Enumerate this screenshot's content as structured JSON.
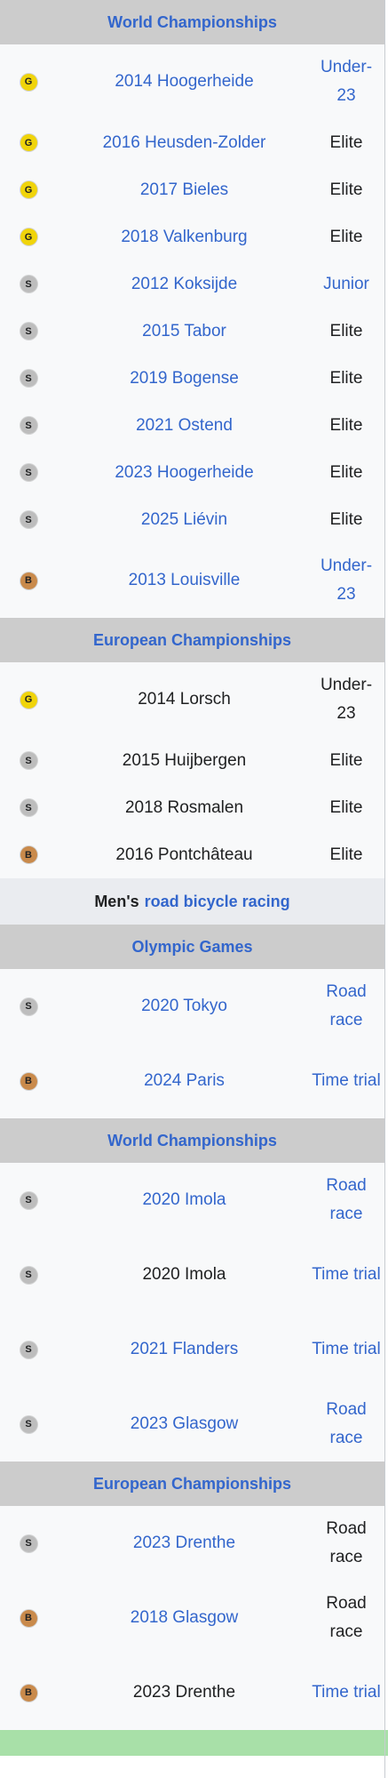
{
  "sections": [
    {
      "type": "header",
      "title": "World Championships",
      "rows": [
        {
          "medal": "G",
          "kind": "gold",
          "event": "2014 Hoogerheide",
          "event_link": true,
          "category": "Under-23",
          "cat_link": true,
          "tall": true
        },
        {
          "medal": "G",
          "kind": "gold",
          "event": "2016 Heusden-Zolder",
          "event_link": true,
          "category": "Elite",
          "cat_link": false,
          "tall": false
        },
        {
          "medal": "G",
          "kind": "gold",
          "event": "2017 Bieles",
          "event_link": true,
          "category": "Elite",
          "cat_link": false,
          "tall": false
        },
        {
          "medal": "G",
          "kind": "gold",
          "event": "2018 Valkenburg",
          "event_link": true,
          "category": "Elite",
          "cat_link": false,
          "tall": false
        },
        {
          "medal": "S",
          "kind": "silver",
          "event": "2012 Koksijde",
          "event_link": true,
          "category": "Junior",
          "cat_link": true,
          "tall": false
        },
        {
          "medal": "S",
          "kind": "silver",
          "event": "2015 Tabor",
          "event_link": true,
          "category": "Elite",
          "cat_link": false,
          "tall": false
        },
        {
          "medal": "S",
          "kind": "silver",
          "event": "2019 Bogense",
          "event_link": true,
          "category": "Elite",
          "cat_link": false,
          "tall": false
        },
        {
          "medal": "S",
          "kind": "silver",
          "event": "2021 Ostend",
          "event_link": true,
          "category": "Elite",
          "cat_link": false,
          "tall": false
        },
        {
          "medal": "S",
          "kind": "silver",
          "event": "2023 Hoogerheide",
          "event_link": true,
          "category": "Elite",
          "cat_link": false,
          "tall": false
        },
        {
          "medal": "S",
          "kind": "silver",
          "event": "2025 Liévin",
          "event_link": true,
          "category": "Elite",
          "cat_link": false,
          "tall": false
        },
        {
          "medal": "B",
          "kind": "bronze",
          "event": "2013 Louisville",
          "event_link": true,
          "category": "Under-23",
          "cat_link": true,
          "tall": true
        }
      ]
    },
    {
      "type": "header",
      "title": "European Championships",
      "rows": [
        {
          "medal": "G",
          "kind": "gold",
          "event": "2014 Lorsch",
          "event_link": false,
          "category": "Under-23",
          "cat_link": false,
          "tall": true
        },
        {
          "medal": "S",
          "kind": "silver",
          "event": "2015 Huijbergen",
          "event_link": false,
          "category": "Elite",
          "cat_link": false,
          "tall": false
        },
        {
          "medal": "S",
          "kind": "silver",
          "event": "2018 Rosmalen",
          "event_link": false,
          "category": "Elite",
          "cat_link": false,
          "tall": false
        },
        {
          "medal": "B",
          "kind": "bronze",
          "event": "2016 Pontchâteau",
          "event_link": false,
          "category": "Elite",
          "cat_link": false,
          "tall": false
        }
      ]
    },
    {
      "type": "subheader",
      "prefix": "Men's",
      "link": "road bicycle racing",
      "rows": []
    },
    {
      "type": "header",
      "title": "Olympic Games",
      "rows": [
        {
          "medal": "S",
          "kind": "silver",
          "event": "2020 Tokyo",
          "event_link": true,
          "category": "Road race",
          "cat_link": true,
          "tall": true
        },
        {
          "medal": "B",
          "kind": "bronze",
          "event": "2024 Paris",
          "event_link": true,
          "category": "Time trial",
          "cat_link": true,
          "tall": true
        }
      ]
    },
    {
      "type": "header",
      "title": "World Championships",
      "rows": [
        {
          "medal": "S",
          "kind": "silver",
          "event": "2020 Imola",
          "event_link": true,
          "category": "Road race",
          "cat_link": true,
          "tall": true
        },
        {
          "medal": "S",
          "kind": "silver",
          "event": "2020 Imola",
          "event_link": false,
          "category": "Time trial",
          "cat_link": true,
          "tall": true
        },
        {
          "medal": "S",
          "kind": "silver",
          "event": "2021 Flanders",
          "event_link": true,
          "category": "Time trial",
          "cat_link": true,
          "tall": true
        },
        {
          "medal": "S",
          "kind": "silver",
          "event": "2023 Glasgow",
          "event_link": true,
          "category": "Road race",
          "cat_link": true,
          "tall": true
        }
      ]
    },
    {
      "type": "header",
      "title": "European Championships",
      "rows": [
        {
          "medal": "S",
          "kind": "silver",
          "event": "2023 Drenthe",
          "event_link": true,
          "category": "Road race",
          "cat_link": false,
          "tall": true
        },
        {
          "medal": "B",
          "kind": "bronze",
          "event": "2018 Glasgow",
          "event_link": true,
          "category": "Road race",
          "cat_link": false,
          "tall": true
        },
        {
          "medal": "B",
          "kind": "bronze",
          "event": "2023 Drenthe",
          "event_link": false,
          "category": "Time trial",
          "cat_link": true,
          "tall": true
        }
      ]
    }
  ],
  "colors": {
    "link": "#3366cc",
    "header_bg": "#cccccc",
    "subheader_bg": "#eaecf0",
    "gold": "#f0d40a",
    "silver": "#bdbdbd",
    "bronze": "#c98a4b",
    "footer_bar": "#a8e0a8"
  }
}
